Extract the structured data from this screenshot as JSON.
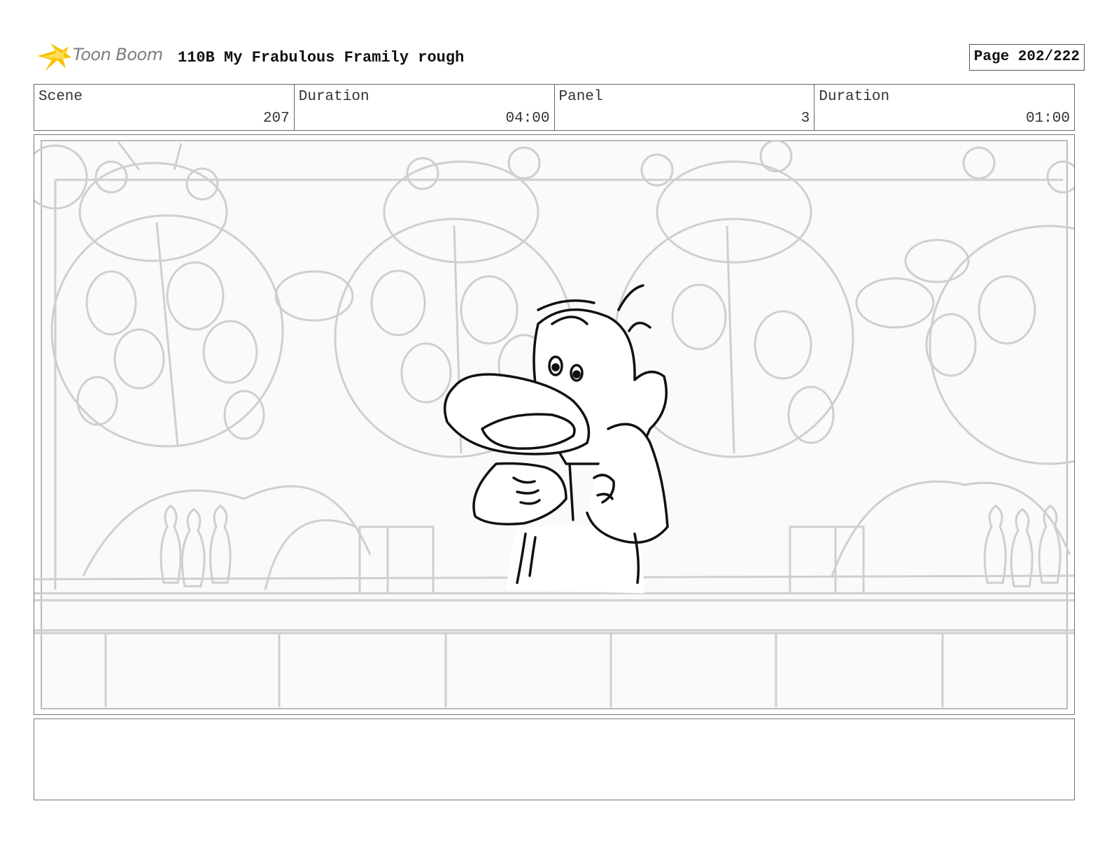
{
  "header": {
    "logo_text": "Toon Boom",
    "project_title": "110B My Frabulous Framily rough",
    "page_indicator": "Page 202/222"
  },
  "info": {
    "scene_label": "Scene",
    "scene_value": "207",
    "scene_duration_label": "Duration",
    "scene_duration_value": "04:00",
    "panel_label": "Panel",
    "panel_value": "3",
    "panel_duration_label": "Duration",
    "panel_duration_value": "01:00"
  },
  "notes": {
    "text": ""
  },
  "colors": {
    "logo_yellow": "#f5c400",
    "background_sketch": "#cfcfcf",
    "character_lines": "#111111"
  }
}
